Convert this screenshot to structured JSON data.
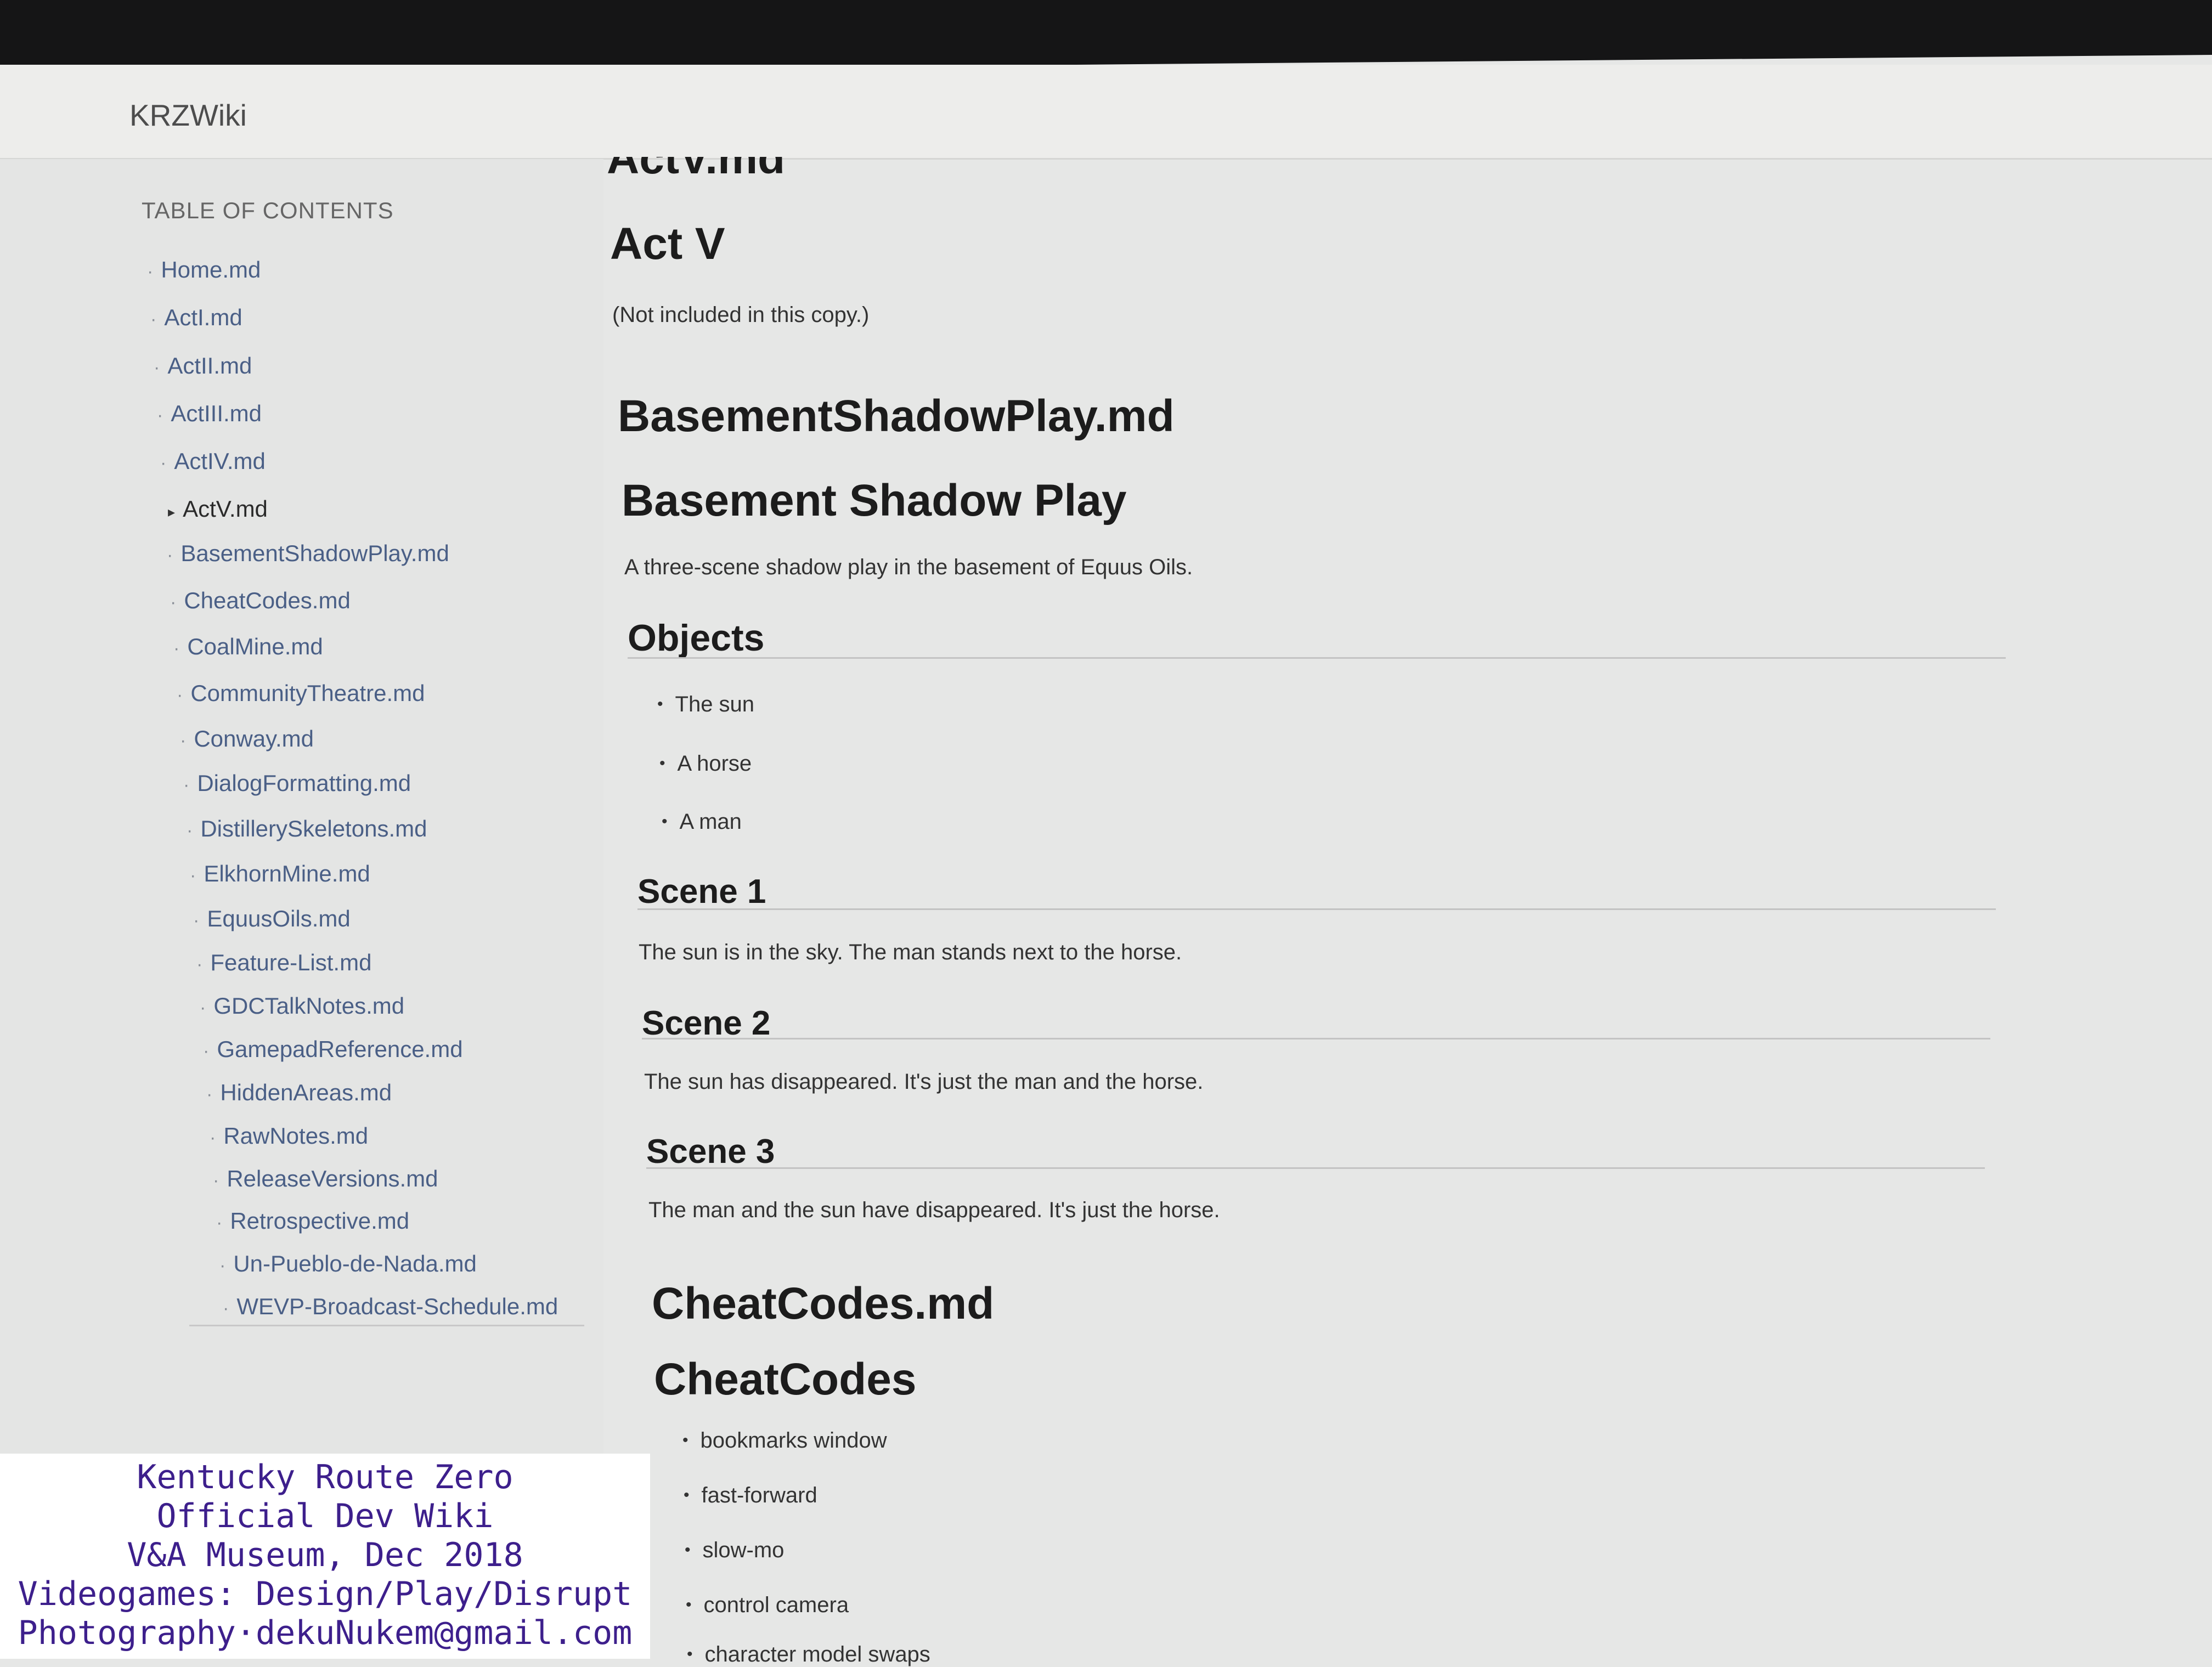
{
  "app": {
    "brand": "KRZWiki"
  },
  "sidebar": {
    "title": "TABLE OF CONTENTS",
    "items": [
      {
        "label": "Home.md"
      },
      {
        "label": "ActI.md"
      },
      {
        "label": "ActII.md"
      },
      {
        "label": "ActIII.md"
      },
      {
        "label": "ActIV.md"
      },
      {
        "label": "ActV.md",
        "active": true
      },
      {
        "label": "BasementShadowPlay.md"
      },
      {
        "label": "CheatCodes.md"
      },
      {
        "label": "CoalMine.md"
      },
      {
        "label": "CommunityTheatre.md"
      },
      {
        "label": "Conway.md"
      },
      {
        "label": "DialogFormatting.md"
      },
      {
        "label": "DistillerySkeletons.md"
      },
      {
        "label": "ElkhornMine.md"
      },
      {
        "label": "EquusOils.md"
      },
      {
        "label": "Feature-List.md"
      },
      {
        "label": "GDCTalkNotes.md"
      },
      {
        "label": "GamepadReference.md"
      },
      {
        "label": "HiddenAreas.md"
      },
      {
        "label": "RawNotes.md"
      },
      {
        "label": "ReleaseVersions.md"
      },
      {
        "label": "Retrospective.md"
      },
      {
        "label": "Un-Pueblo-de-Nada.md"
      },
      {
        "label": "WEVP-Broadcast-Schedule.md"
      }
    ]
  },
  "content": {
    "cutoff_heading": "ActV.md",
    "actv": {
      "title": "Act V",
      "note": "(Not included in this copy.)"
    },
    "basement": {
      "file_heading": "BasementShadowPlay.md",
      "title": "Basement Shadow Play",
      "intro": "A three-scene shadow play in the basement of Equus Oils.",
      "objects_heading": "Objects",
      "objects": [
        "The sun",
        "A horse",
        "A man"
      ],
      "scenes": [
        {
          "heading": "Scene 1",
          "text": "The sun is in the sky. The man stands next to the horse."
        },
        {
          "heading": "Scene 2",
          "text": "The sun has disappeared. It's just the man and the horse."
        },
        {
          "heading": "Scene 3",
          "text": "The man and the sun have disappeared. It's just the horse."
        }
      ]
    },
    "cheatcodes": {
      "file_heading": "CheatCodes.md",
      "title": "CheatCodes",
      "items": [
        "bookmarks window",
        "fast-forward",
        "slow-mo",
        "control camera",
        "character model swaps"
      ]
    }
  },
  "caption": {
    "lines": [
      "Kentucky Route Zero",
      "Official Dev Wiki",
      "V&A Museum, Dec 2018",
      "Videogames: Design/Play/Disrupt",
      "Photography·dekuNukem@gmail.com"
    ]
  }
}
